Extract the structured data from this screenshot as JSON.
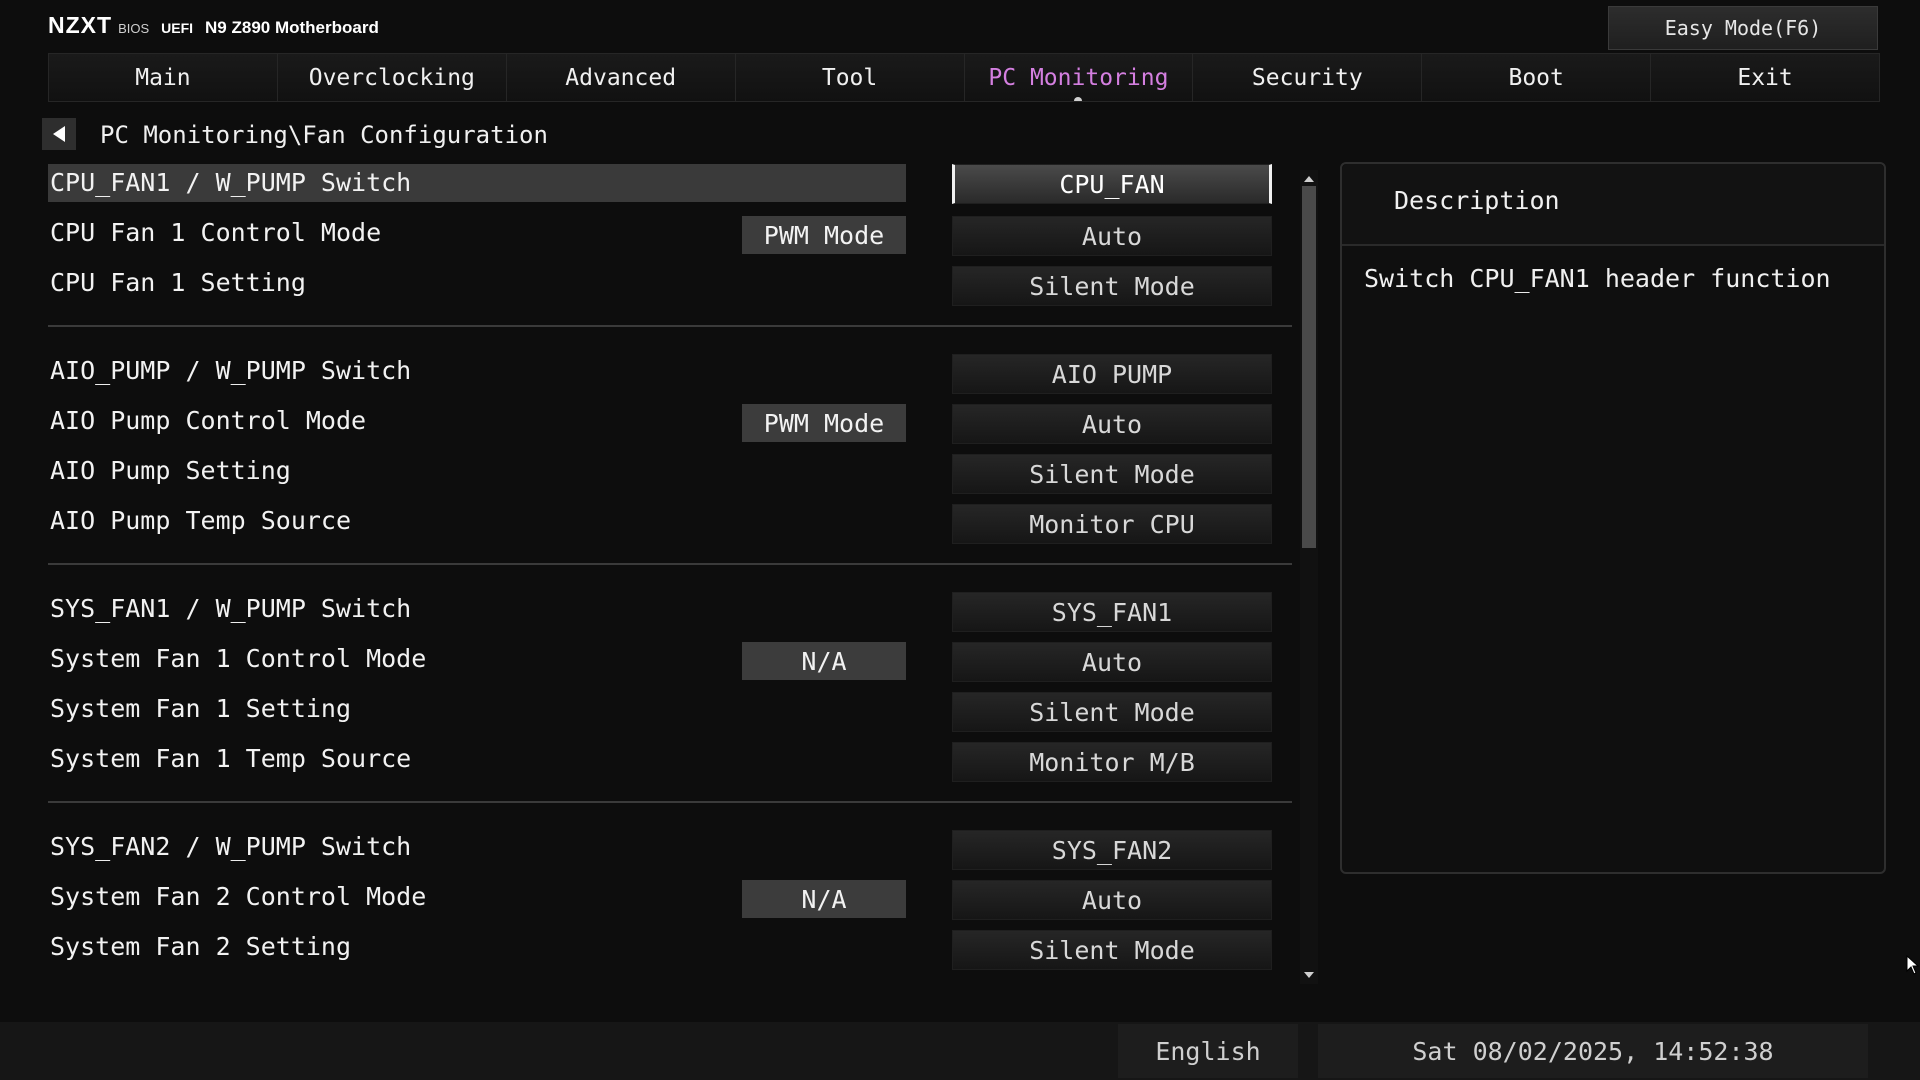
{
  "brand": {
    "logo": "NZXT",
    "bios": "BIOS",
    "uefi": "UEFI",
    "model": "N9 Z890 Motherboard"
  },
  "easy_mode_label": "Easy Mode(F6)",
  "tabs": [
    {
      "label": "Main"
    },
    {
      "label": "Overclocking"
    },
    {
      "label": "Advanced"
    },
    {
      "label": "Tool"
    },
    {
      "label": "PC Monitoring",
      "active": true
    },
    {
      "label": "Security"
    },
    {
      "label": "Boot"
    },
    {
      "label": "Exit"
    }
  ],
  "breadcrumb": "PC Monitoring\\Fan Configuration",
  "settings": [
    {
      "label": "CPU_FAN1 / W_PUMP Switch",
      "value": "CPU_FAN",
      "selected": true
    },
    {
      "label": "CPU Fan 1 Control Mode",
      "mode": "PWM Mode",
      "value": "Auto"
    },
    {
      "label": "CPU Fan 1 Setting",
      "value": "Silent Mode"
    },
    {
      "label": "AIO_PUMP / W_PUMP Switch",
      "value": "AIO PUMP"
    },
    {
      "label": "AIO Pump Control Mode",
      "mode": "PWM Mode",
      "value": "Auto"
    },
    {
      "label": "AIO Pump Setting",
      "value": "Silent Mode"
    },
    {
      "label": "AIO Pump Temp Source",
      "value": "Monitor CPU"
    },
    {
      "label": "SYS_FAN1 / W_PUMP Switch",
      "value": "SYS_FAN1"
    },
    {
      "label": "System Fan 1 Control Mode",
      "mode": "N/A",
      "value": "Auto"
    },
    {
      "label": "System Fan 1 Setting",
      "value": "Silent Mode"
    },
    {
      "label": "System Fan 1 Temp Source",
      "value": "Monitor M/B"
    },
    {
      "label": "SYS_FAN2 / W_PUMP Switch",
      "value": "SYS_FAN2"
    },
    {
      "label": "System Fan 2 Control Mode",
      "mode": "N/A",
      "value": "Auto"
    },
    {
      "label": "System Fan 2 Setting",
      "value": "Silent Mode"
    }
  ],
  "description": {
    "title": "Description",
    "text": "Switch CPU_FAN1 header function"
  },
  "footer": {
    "language": "English",
    "datetime": "Sat 08/02/2025, 14:52:38"
  },
  "colors": {
    "active_tab": "#d47fe0",
    "background": "#0d0d0d"
  }
}
